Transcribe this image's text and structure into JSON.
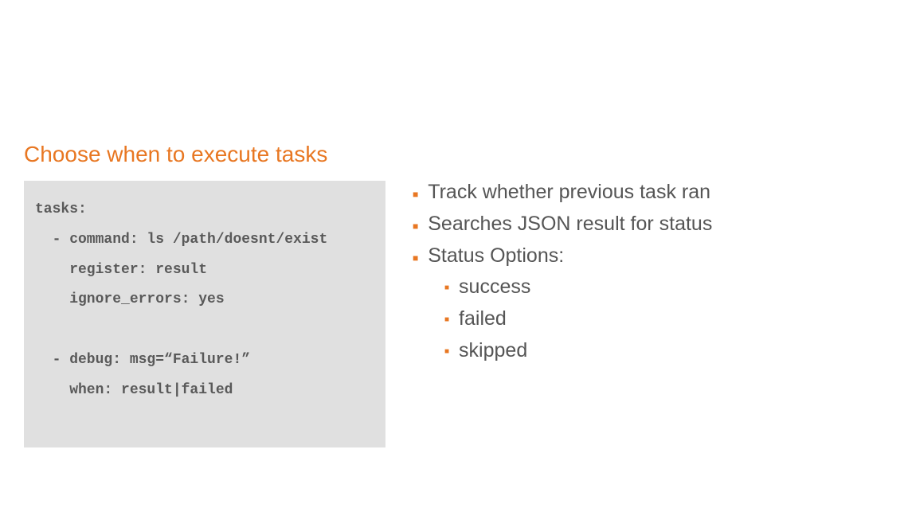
{
  "title": "Choose when to execute tasks",
  "code": "tasks:\n  - command: ls /path/doesnt/exist\n    register: result\n    ignore_errors: yes\n\n  - debug: msg=“Failure!”\n    when: result|failed",
  "bullets": [
    {
      "level": 1,
      "text": "Track whether previous task ran"
    },
    {
      "level": 1,
      "text": "Searches JSON result for status"
    },
    {
      "level": 1,
      "text": "Status Options:"
    },
    {
      "level": 2,
      "text": "success"
    },
    {
      "level": 2,
      "text": "failed"
    },
    {
      "level": 2,
      "text": "skipped"
    }
  ]
}
